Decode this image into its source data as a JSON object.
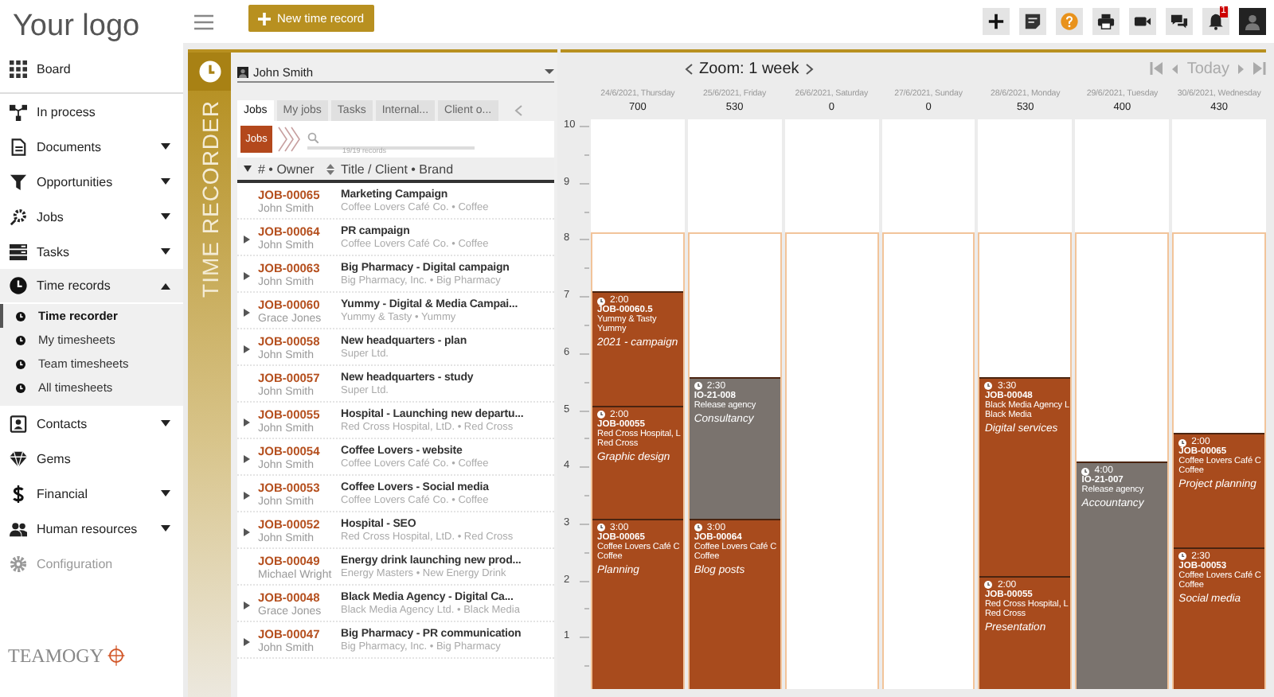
{
  "sidebar": {
    "logo": "Your logo",
    "items": [
      {
        "label": "Board",
        "caret": false,
        "expanded": false,
        "disabled": false
      },
      {
        "label": "In process",
        "caret": false,
        "expanded": false,
        "disabled": false
      },
      {
        "label": "Documents",
        "caret": true,
        "expanded": false,
        "disabled": false
      },
      {
        "label": "Opportunities",
        "caret": true,
        "expanded": false,
        "disabled": false
      },
      {
        "label": "Jobs",
        "caret": true,
        "expanded": false,
        "disabled": false
      },
      {
        "label": "Tasks",
        "caret": true,
        "expanded": false,
        "disabled": false
      },
      {
        "label": "Time records",
        "caret": true,
        "expanded": true,
        "disabled": false,
        "children": [
          {
            "label": "Time recorder",
            "selected": true
          },
          {
            "label": "My timesheets",
            "selected": false
          },
          {
            "label": "Team timesheets",
            "selected": false
          },
          {
            "label": "All timesheets",
            "selected": false
          }
        ]
      },
      {
        "label": "Contacts",
        "caret": true,
        "expanded": false,
        "disabled": false
      },
      {
        "label": "Gems",
        "caret": false,
        "expanded": false,
        "disabled": false
      },
      {
        "label": "Financial",
        "caret": true,
        "expanded": false,
        "disabled": false
      },
      {
        "label": "Human resources",
        "caret": true,
        "expanded": false,
        "disabled": false
      },
      {
        "label": "Configuration",
        "caret": false,
        "expanded": false,
        "disabled": true
      }
    ],
    "brand": "TEAMOGY"
  },
  "toolbar": {
    "new_button": "New time record",
    "notification_count": "1"
  },
  "time_recorder": {
    "title": "TIME RECORDER",
    "user": "John Smith",
    "tabs": [
      {
        "label": "Jobs",
        "selected": true
      },
      {
        "label": "My jobs",
        "selected": false
      },
      {
        "label": "Tasks",
        "selected": false
      },
      {
        "label": "Internal...",
        "selected": false
      },
      {
        "label": "Client o...",
        "selected": false
      }
    ],
    "badge": "Jobs",
    "records": "19/19 records",
    "columns": [
      "# • Owner",
      "Title / Client • Brand"
    ],
    "rows": [
      {
        "code": "JOB-00065",
        "owner": "John Smith",
        "title": "Marketing Campaign",
        "client": "Coffee Lovers Café Co. • Coffee",
        "expandable": false
      },
      {
        "code": "JOB-00064",
        "owner": "John Smith",
        "title": "PR campaign",
        "client": "Coffee Lovers Café Co. • Coffee",
        "expandable": true
      },
      {
        "code": "JOB-00063",
        "owner": "John Smith",
        "title": "Big Pharmacy - Digital campaign",
        "client": "Big Pharmacy, Inc. • Big Pharmacy",
        "expandable": true
      },
      {
        "code": "JOB-00060",
        "owner": "Grace Jones",
        "title": "Yummy - Digital & Media Campai...",
        "client": "Yummy & Tasty • Yummy",
        "expandable": true
      },
      {
        "code": "JOB-00058",
        "owner": "John Smith",
        "title": "New headquarters - plan",
        "client": "Super Ltd.",
        "expandable": true
      },
      {
        "code": "JOB-00057",
        "owner": "John Smith",
        "title": "New headquarters - study",
        "client": "Super Ltd.",
        "expandable": false
      },
      {
        "code": "JOB-00055",
        "owner": "John Smith",
        "title": "Hospital - Launching new departu...",
        "client": "Red Cross Hospital, LtD. • Red Cross",
        "expandable": true
      },
      {
        "code": "JOB-00054",
        "owner": "John Smith",
        "title": "Coffee Lovers - website",
        "client": "Coffee Lovers Café Co. • Coffee",
        "expandable": true
      },
      {
        "code": "JOB-00053",
        "owner": "John Smith",
        "title": "Coffee Lovers - Social media",
        "client": "Coffee Lovers Café Co. • Coffee",
        "expandable": true
      },
      {
        "code": "JOB-00052",
        "owner": "John Smith",
        "title": "Hospital - SEO",
        "client": "Red Cross Hospital, LtD. • Red Cross",
        "expandable": true
      },
      {
        "code": "JOB-00049",
        "owner": "Michael Wright",
        "title": "Energy drink launching new prod...",
        "client": "Energy Masters • New Energy Drink",
        "expandable": false
      },
      {
        "code": "JOB-00048",
        "owner": "Grace Jones",
        "title": "Black Media Agency - Digital Ca...",
        "client": "Black Media Agency Ltd. • Black Media",
        "expandable": true
      },
      {
        "code": "JOB-00047",
        "owner": "John Smith",
        "title": "Big Pharmacy - PR communication",
        "client": "Big Pharmacy, Inc. • Big Pharmacy",
        "expandable": true
      }
    ]
  },
  "calendar": {
    "zoom": "Zoom: 1 week",
    "today": "Today",
    "hours": [
      "10",
      "9",
      "8",
      "7",
      "6",
      "5",
      "4",
      "3",
      "2",
      "1"
    ],
    "days": [
      {
        "date": "24/6/2021, Thursday",
        "total": "700",
        "events": [
          {
            "kind": "job",
            "duration": "2:00",
            "code": "JOB-00060.5",
            "client": "Yummy & Tasty",
            "brand": "Yummy",
            "task": "2021 - campaign"
          },
          {
            "kind": "job",
            "duration": "2:00",
            "code": "JOB-00055",
            "client": "Red Cross Hospital, L",
            "brand": "Red Cross",
            "task": "Graphic design"
          },
          {
            "kind": "job",
            "duration": "3:00",
            "code": "JOB-00065",
            "client": "Coffee Lovers Café C",
            "brand": "Coffee",
            "task": "Planning"
          }
        ]
      },
      {
        "date": "25/6/2021, Friday",
        "total": "530",
        "events": [
          {
            "kind": "internal",
            "duration": "2:30",
            "code": "IO-21-008",
            "client": "Release agency",
            "task": "Consultancy"
          },
          {
            "kind": "job",
            "duration": "3:00",
            "code": "JOB-00064",
            "client": "Coffee Lovers Café C",
            "brand": "Coffee",
            "task": "Blog posts"
          }
        ]
      },
      {
        "date": "26/6/2021, Saturday",
        "total": "0"
      },
      {
        "date": "27/6/2021, Sunday",
        "total": "0"
      },
      {
        "date": "28/6/2021, Monday",
        "total": "530",
        "events": [
          {
            "kind": "job",
            "duration": "3:30",
            "code": "JOB-00048",
            "client": "Black Media Agency L",
            "brand": "Black Media",
            "task": "Digital services"
          },
          {
            "kind": "job",
            "duration": "2:00",
            "code": "JOB-00055",
            "client": "Red Cross Hospital, L",
            "brand": "Red Cross",
            "task": "Presentation"
          }
        ]
      },
      {
        "date": "29/6/2021, Tuesday",
        "total": "400",
        "events": [
          {
            "kind": "internal",
            "duration": "4:00",
            "code": "IO-21-007",
            "client": "Release agency",
            "task": "Accountancy"
          }
        ]
      },
      {
        "date": "30/6/2021, Wednesday",
        "total": "430",
        "events": [
          {
            "kind": "job",
            "duration": "2:00",
            "code": "JOB-00065",
            "client": "Coffee Lovers Café C",
            "brand": "Coffee",
            "task": "Project planning"
          },
          {
            "kind": "job",
            "duration": "2:30",
            "code": "JOB-00053",
            "client": "Coffee Lovers Café C",
            "brand": "Coffee",
            "task": "Social media"
          }
        ]
      }
    ]
  }
}
